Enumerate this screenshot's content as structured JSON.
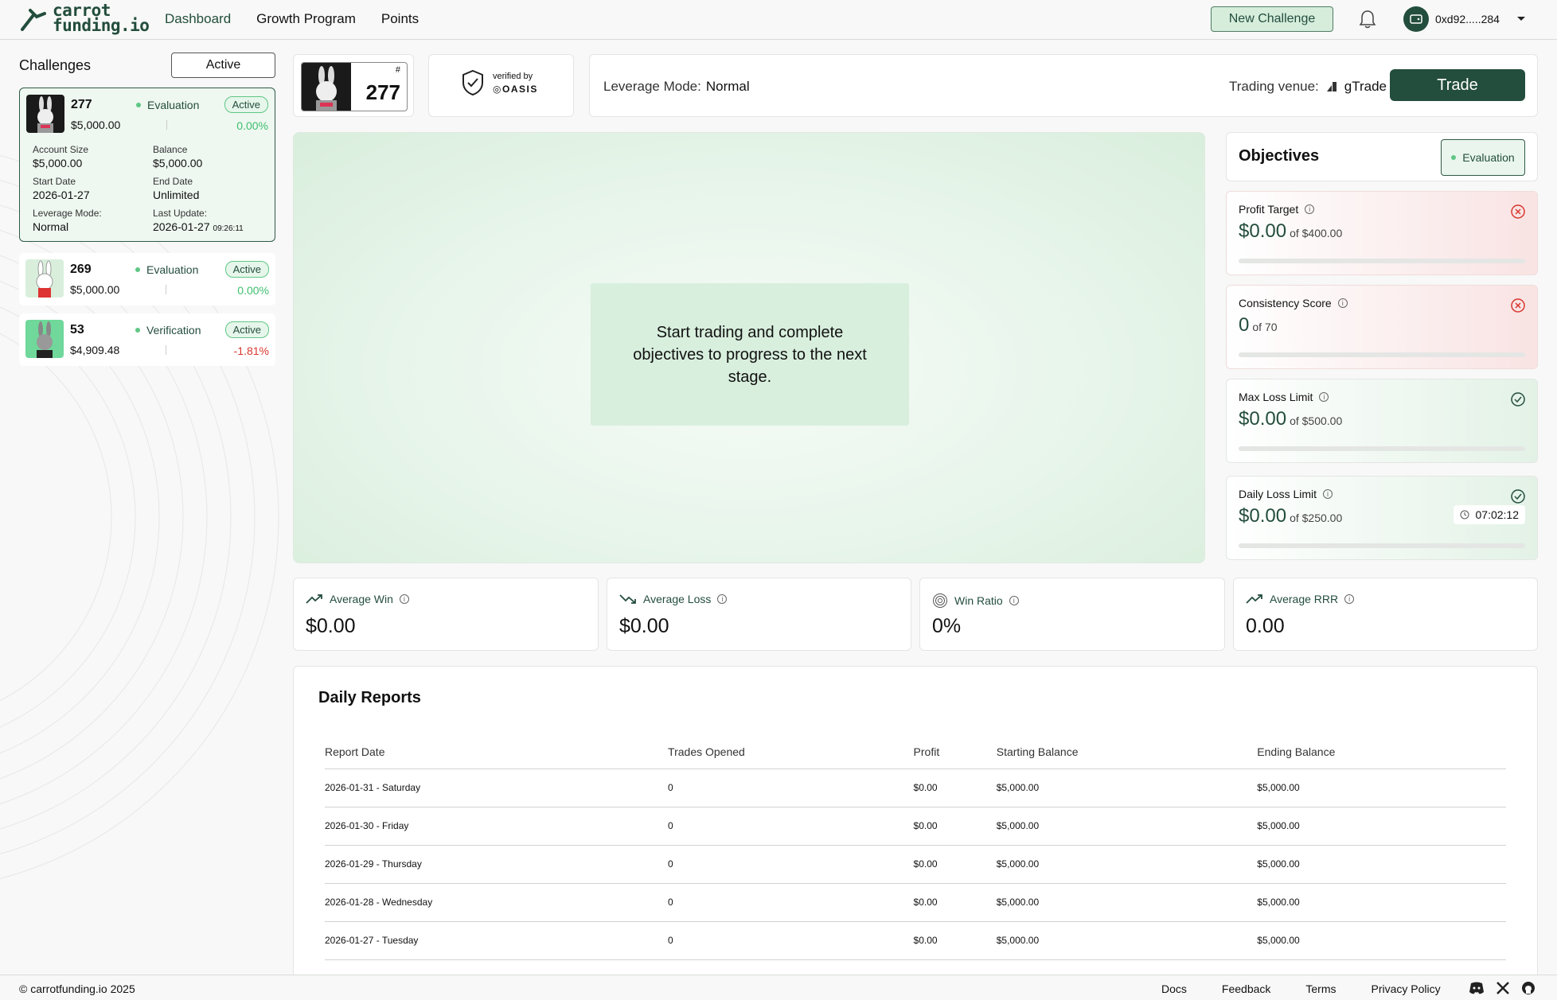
{
  "brand": {
    "line1": "carrot",
    "line2": "funding.io"
  },
  "nav": {
    "dashboard": "Dashboard",
    "growth": "Growth Program",
    "points": "Points"
  },
  "header": {
    "new_challenge": "New Challenge",
    "wallet": "0xd92.....284"
  },
  "sidebar": {
    "title": "Challenges",
    "filter": "Active",
    "challenges": [
      {
        "id": "277",
        "phase": "Evaluation",
        "status": "Active",
        "amount": "$5,000.00",
        "pct": "0.00%",
        "details": {
          "account_size_label": "Account Size",
          "account_size": "$5,000.00",
          "balance_label": "Balance",
          "balance": "$5,000.00",
          "start_label": "Start Date",
          "start": "2026-01-27",
          "end_label": "End Date",
          "end": "Unlimited",
          "leverage_label": "Leverage Mode:",
          "leverage": "Normal",
          "update_label": "Last Update:",
          "update_date": "2026-01-27",
          "update_time": "09:26:11"
        }
      },
      {
        "id": "269",
        "phase": "Evaluation",
        "status": "Active",
        "amount": "$5,000.00",
        "pct": "0.00%"
      },
      {
        "id": "53",
        "phase": "Verification",
        "status": "Active",
        "amount": "$4,909.48",
        "pct": "-1.81%"
      }
    ]
  },
  "account": {
    "hash": "#",
    "number": "277"
  },
  "verified": {
    "by": "verified by",
    "name": "OASIS"
  },
  "leverage": {
    "label": "Leverage Mode:",
    "value": "Normal"
  },
  "venue": {
    "label": "Trading venue:",
    "name": "gTrade"
  },
  "trade_button": "Trade",
  "chart_message": "Start trading and complete objectives to progress to the next stage.",
  "objectives": {
    "title": "Objectives",
    "badge": "Evaluation",
    "items": [
      {
        "label": "Profit Target",
        "value": "$0.00",
        "of": "of $400.00",
        "progress": 0,
        "state": "failed"
      },
      {
        "label": "Consistency Score",
        "value": "0",
        "of": "of 70",
        "progress": 0,
        "state": "failed"
      },
      {
        "label": "Max Loss Limit",
        "value": "$0.00",
        "of": "of $500.00",
        "progress": 0,
        "state": "passed"
      },
      {
        "label": "Daily Loss Limit",
        "value": "$0.00",
        "of": "of $250.00",
        "progress": 0,
        "state": "passed",
        "timer": "07:02:12"
      }
    ]
  },
  "stats": [
    {
      "label": "Average Win",
      "value": "$0.00",
      "icon": "trending-up-icon"
    },
    {
      "label": "Average Loss",
      "value": "$0.00",
      "icon": "trending-down-icon"
    },
    {
      "label": "Win Ratio",
      "value": "0%",
      "icon": "target-icon"
    },
    {
      "label": "Average RRR",
      "value": "0.00",
      "icon": "trending-up-icon"
    }
  ],
  "reports": {
    "title": "Daily Reports",
    "columns": [
      "Report Date",
      "Trades Opened",
      "Profit",
      "Starting Balance",
      "Ending Balance"
    ],
    "rows": [
      [
        "2026-01-31 - Saturday",
        "0",
        "$0.00",
        "$5,000.00",
        "$5,000.00"
      ],
      [
        "2026-01-30 - Friday",
        "0",
        "$0.00",
        "$5,000.00",
        "$5,000.00"
      ],
      [
        "2026-01-29 - Thursday",
        "0",
        "$0.00",
        "$5,000.00",
        "$5,000.00"
      ],
      [
        "2026-01-28 - Wednesday",
        "0",
        "$0.00",
        "$5,000.00",
        "$5,000.00"
      ],
      [
        "2026-01-27 - Tuesday",
        "0",
        "$0.00",
        "$5,000.00",
        "$5,000.00"
      ]
    ]
  },
  "footer": {
    "copyright": "© carrotfunding.io 2025",
    "docs": "Docs",
    "feedback": "Feedback",
    "terms": "Terms",
    "privacy": "Privacy Policy"
  },
  "colors": {
    "brand": "#234d3d",
    "positive": "#3fbf6f",
    "negative": "#d9362e",
    "accent_bg": "#d6eddc"
  }
}
